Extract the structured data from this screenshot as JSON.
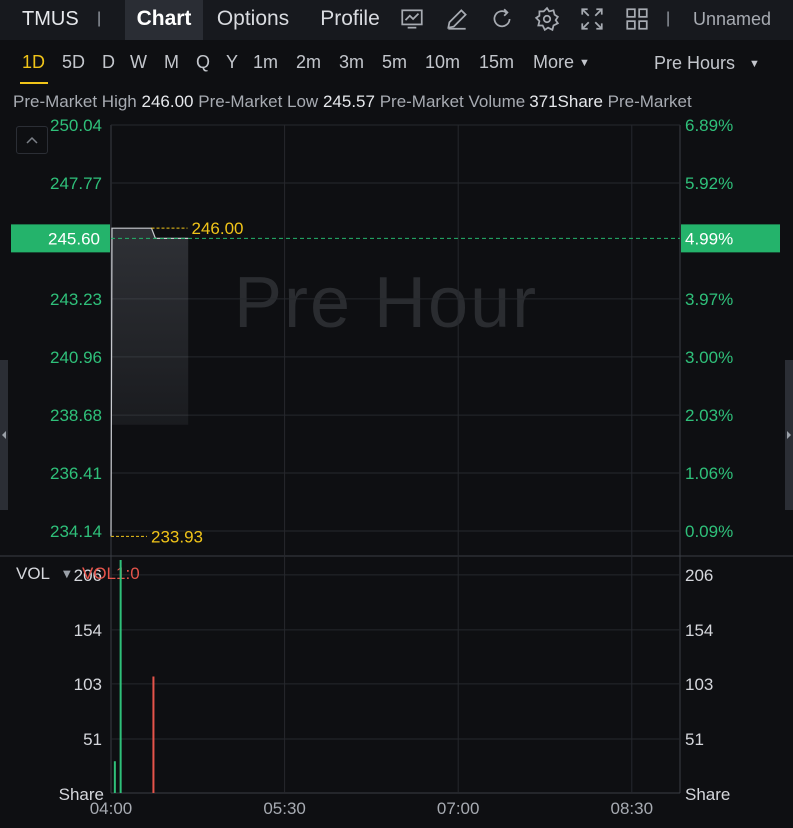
{
  "topbar": {
    "symbol": "TMUS",
    "separator": "|",
    "tabs": [
      {
        "label": "Chart",
        "active": true
      },
      {
        "label": "Options",
        "active": false
      },
      {
        "label": "Profile",
        "active": false
      }
    ],
    "icons": [
      "chart-line-icon",
      "pencil-icon",
      "refresh-icon",
      "gear-icon",
      "fullscreen-icon",
      "grid-icon"
    ],
    "layout_name": "Unnamed"
  },
  "periods": {
    "items": [
      "1D",
      "5D",
      "D",
      "W",
      "M",
      "Q",
      "Y",
      "1m",
      "2m",
      "3m",
      "5m",
      "10m",
      "15m"
    ],
    "active": "1D",
    "more_label": "More",
    "session_label": "Pre Hours"
  },
  "infobar": {
    "high_label": "Pre-Market High",
    "high_value": "246.00",
    "low_label": "Pre-Market Low",
    "low_value": "245.57",
    "volume_label": "Pre-Market Volume",
    "volume_value": "371Share",
    "trailing_label": "Pre-Market"
  },
  "watermark": "Pre Hour",
  "volume_panel": {
    "label": "VOL",
    "indicator": "VOL1:0",
    "unit_label": "Share"
  },
  "colors": {
    "up": "#2fc07a",
    "down": "#e5544b",
    "marker": "#f0c419",
    "price_badge": "#24b36b",
    "grid": "#26282d",
    "axis_text": "#2fc07a"
  },
  "chart_data": {
    "type": "line",
    "price_axis": {
      "ylim": [
        233.2,
        250.04
      ],
      "ticks": [
        250.04,
        247.77,
        245.6,
        243.23,
        240.96,
        238.68,
        236.41,
        234.14
      ],
      "tick_labels": [
        "250.04",
        "247.77",
        "245.60",
        "243.23",
        "240.96",
        "238.68",
        "236.41",
        "234.14"
      ],
      "pct_ticks": [
        250.04,
        247.77,
        245.6,
        243.23,
        240.96,
        238.68,
        236.41,
        234.14
      ],
      "pct_labels": [
        "6.89%",
        "5.92%",
        "4.99%",
        "3.97%",
        "3.00%",
        "2.03%",
        "1.06%",
        "0.09%"
      ],
      "current_price": 245.6,
      "current_price_label": "245.60",
      "current_pct_label": "4.99%"
    },
    "x_axis": {
      "range_minutes": [
        0,
        295
      ],
      "ticks_minutes": [
        0,
        90,
        180,
        270
      ],
      "tick_labels": [
        "04:00",
        "05:30",
        "07:00",
        "08:30"
      ]
    },
    "price_series": {
      "x_minutes": [
        0,
        0.5,
        21,
        23,
        40
      ],
      "y": [
        233.93,
        246.0,
        246.0,
        245.6,
        245.6
      ]
    },
    "markers": [
      {
        "label": "246.00",
        "value": 246.0,
        "x_minutes": 21
      },
      {
        "label": "233.93",
        "value": 233.93,
        "x_minutes": 0
      }
    ],
    "volume": {
      "ylim": [
        0,
        220
      ],
      "ticks": [
        206,
        154,
        103,
        51
      ],
      "tick_labels": [
        "206",
        "154",
        "103",
        "51"
      ],
      "bars": [
        {
          "x_minutes": 2,
          "value": 30,
          "dir": "up"
        },
        {
          "x_minutes": 5,
          "value": 220,
          "dir": "up"
        },
        {
          "x_minutes": 22,
          "value": 110,
          "dir": "down"
        }
      ]
    }
  }
}
